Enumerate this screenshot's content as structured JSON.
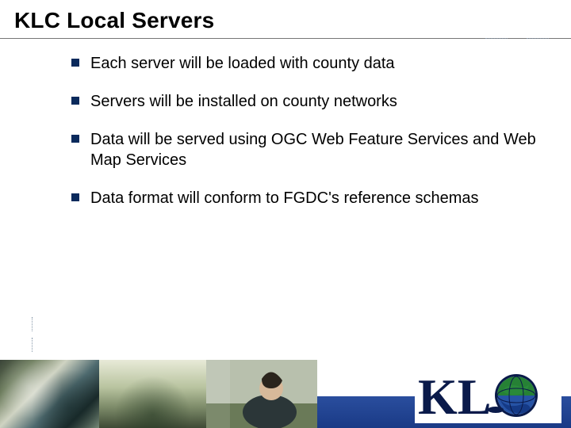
{
  "title": "KLC Local Servers",
  "bullets": [
    "Each server will be loaded with county data",
    "Servers will be installed on county networks",
    "Data will be served using OGC Web Feature Services and Web Map Services",
    "Data format will conform to FGDC's reference schemas"
  ],
  "logo_text": "KL",
  "colors": {
    "bullet_square": "#0a2a5c",
    "footer_bar": "#1a3a86"
  }
}
